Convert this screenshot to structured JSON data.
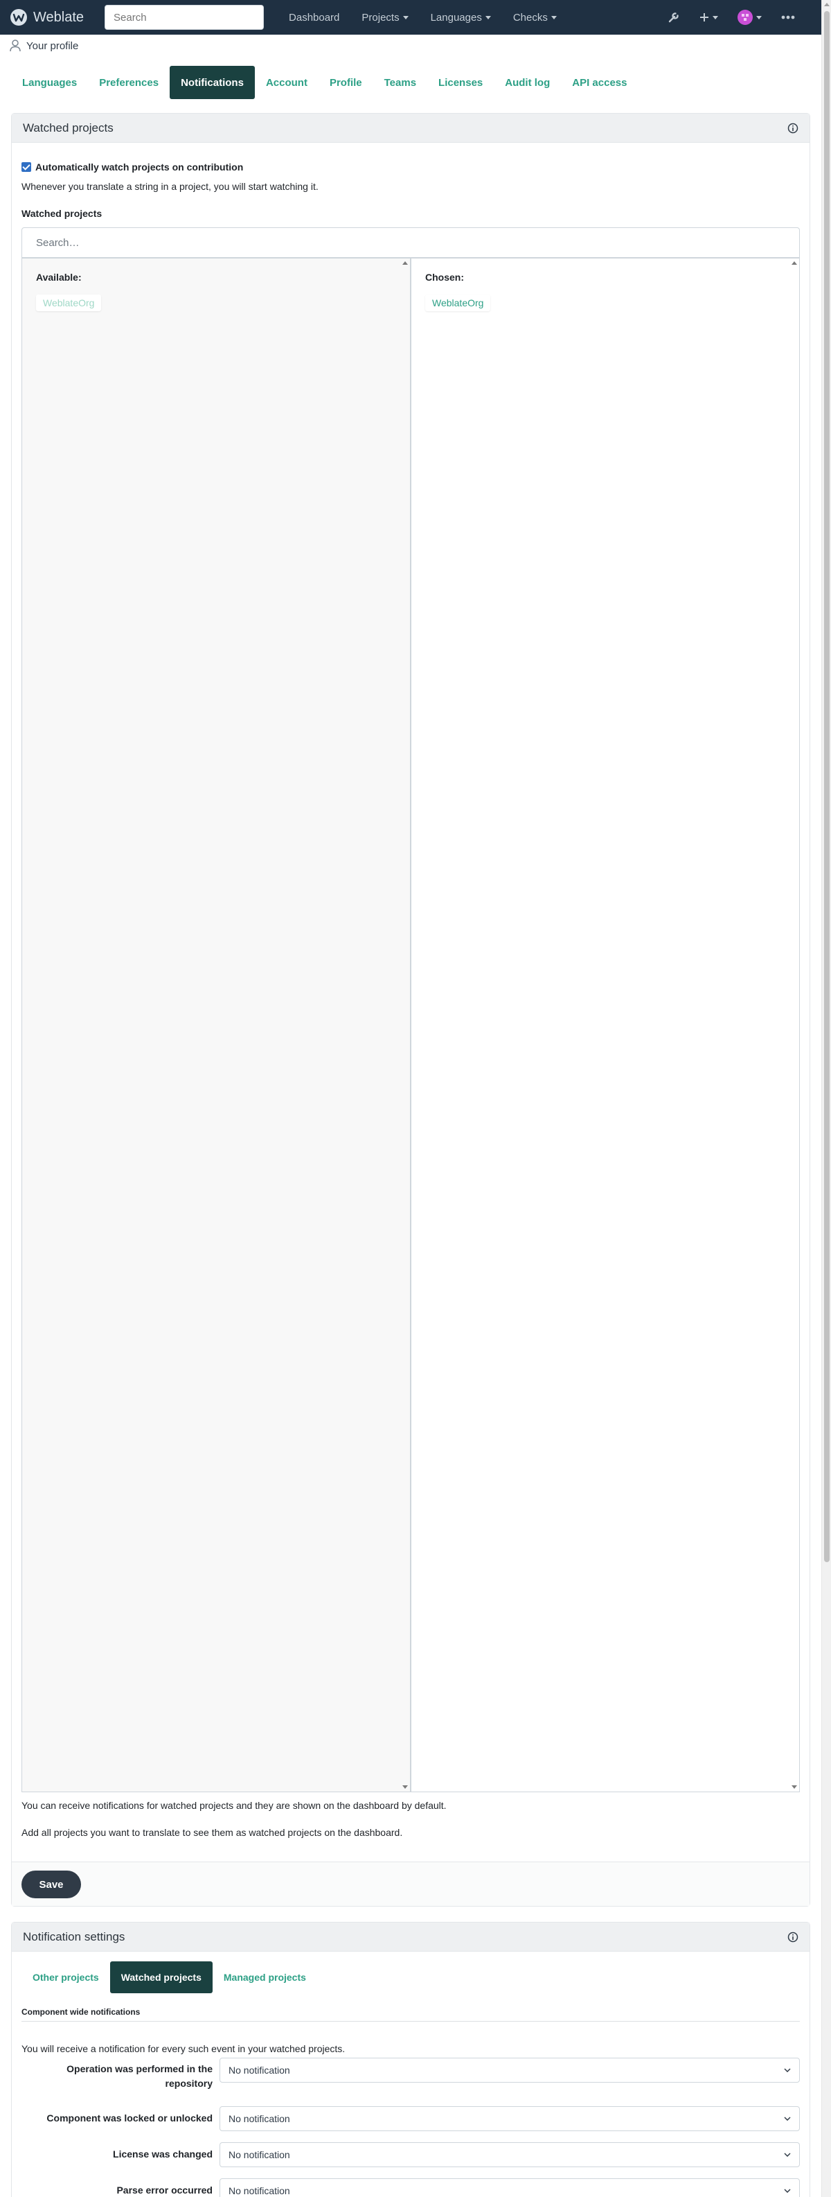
{
  "navbar": {
    "brand": "Weblate",
    "search_placeholder": "Search",
    "links": [
      {
        "label": "Dashboard",
        "dropdown": false
      },
      {
        "label": "Projects",
        "dropdown": true
      },
      {
        "label": "Languages",
        "dropdown": true
      },
      {
        "label": "Checks",
        "dropdown": true
      }
    ],
    "icons": [
      "wrench-icon",
      "plus-icon",
      "avatar-icon",
      "more-icon"
    ]
  },
  "breadcrumb": {
    "label": "Your profile"
  },
  "profile_tabs": [
    {
      "label": "Languages",
      "active": false
    },
    {
      "label": "Preferences",
      "active": false
    },
    {
      "label": "Notifications",
      "active": true
    },
    {
      "label": "Account",
      "active": false
    },
    {
      "label": "Profile",
      "active": false
    },
    {
      "label": "Teams",
      "active": false
    },
    {
      "label": "Licenses",
      "active": false
    },
    {
      "label": "Audit log",
      "active": false
    },
    {
      "label": "API access",
      "active": false
    }
  ],
  "watched": {
    "heading": "Watched projects",
    "auto_watch_label": "Automatically watch projects on contribution",
    "auto_watch_checked": true,
    "auto_watch_help": "Whenever you translate a string in a project, you will start watching it.",
    "field_label": "Watched projects",
    "search_placeholder": "Search…",
    "available_title": "Available:",
    "available_items": [
      "WeblateOrg"
    ],
    "chosen_title": "Chosen:",
    "chosen_items": [
      "WeblateOrg"
    ],
    "help_1": "You can receive notifications for watched projects and they are shown on the dashboard by default.",
    "help_2": "Add all projects you want to translate to see them as watched projects on the dashboard.",
    "save_label": "Save"
  },
  "notification_settings": {
    "heading": "Notification settings",
    "tabs": [
      {
        "label": "Other projects",
        "active": false
      },
      {
        "label": "Watched projects",
        "active": true
      },
      {
        "label": "Managed projects",
        "active": false
      }
    ],
    "section_title": "Component wide notifications",
    "section_help": "You will receive a notification for every such event in your watched projects.",
    "rows": [
      {
        "label": "Operation was performed in the repository",
        "value": "No notification"
      },
      {
        "label": "Component was locked or unlocked",
        "value": "No notification"
      },
      {
        "label": "License was changed",
        "value": "No notification"
      },
      {
        "label": "Parse error occurred",
        "value": "No notification"
      }
    ]
  },
  "colors": {
    "navbar": "#1f3042",
    "accent": "#2da086",
    "active_tab": "#1a4140",
    "button": "#303b47"
  }
}
